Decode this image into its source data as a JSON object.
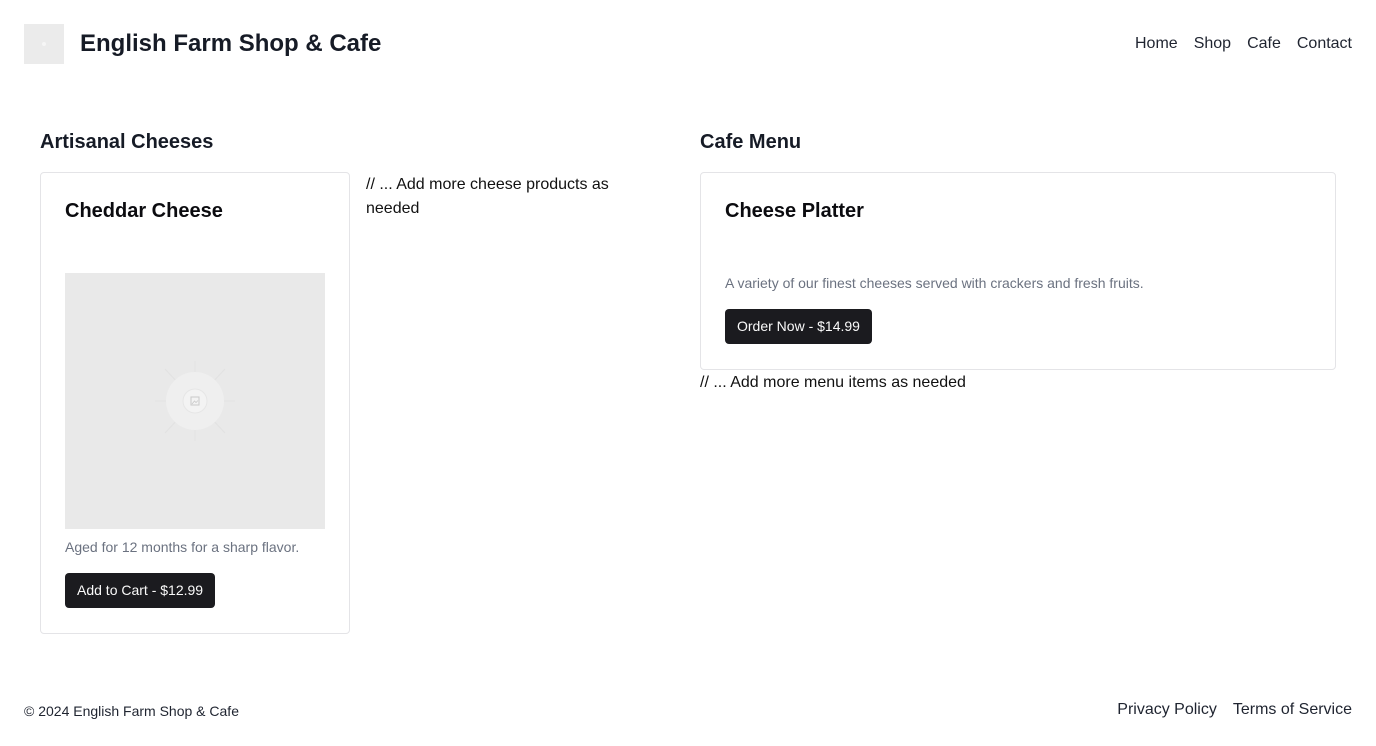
{
  "header": {
    "brand": "English Farm Shop & Cafe",
    "nav": [
      "Home",
      "Shop",
      "Cafe",
      "Contact"
    ]
  },
  "shop": {
    "title": "Artisanal Cheeses",
    "product": {
      "name": "Cheddar Cheese",
      "description": "Aged for 12 months for a sharp flavor.",
      "button": "Add to Cart - $12.99"
    },
    "note": "// ... Add more cheese products as needed"
  },
  "cafe": {
    "title": "Cafe Menu",
    "item": {
      "name": "Cheese Platter",
      "description": "A variety of our finest cheeses served with crackers and fresh fruits.",
      "button": "Order Now - $14.99"
    },
    "note": "// ... Add more menu items as needed"
  },
  "footer": {
    "copyright": "© 2024 English Farm Shop & Cafe",
    "links": [
      "Privacy Policy",
      "Terms of Service"
    ]
  },
  "colors": {
    "button_bg": "#1b1b1f",
    "placeholder_bg": "#e9e9e9",
    "muted_text": "#6b7280"
  }
}
